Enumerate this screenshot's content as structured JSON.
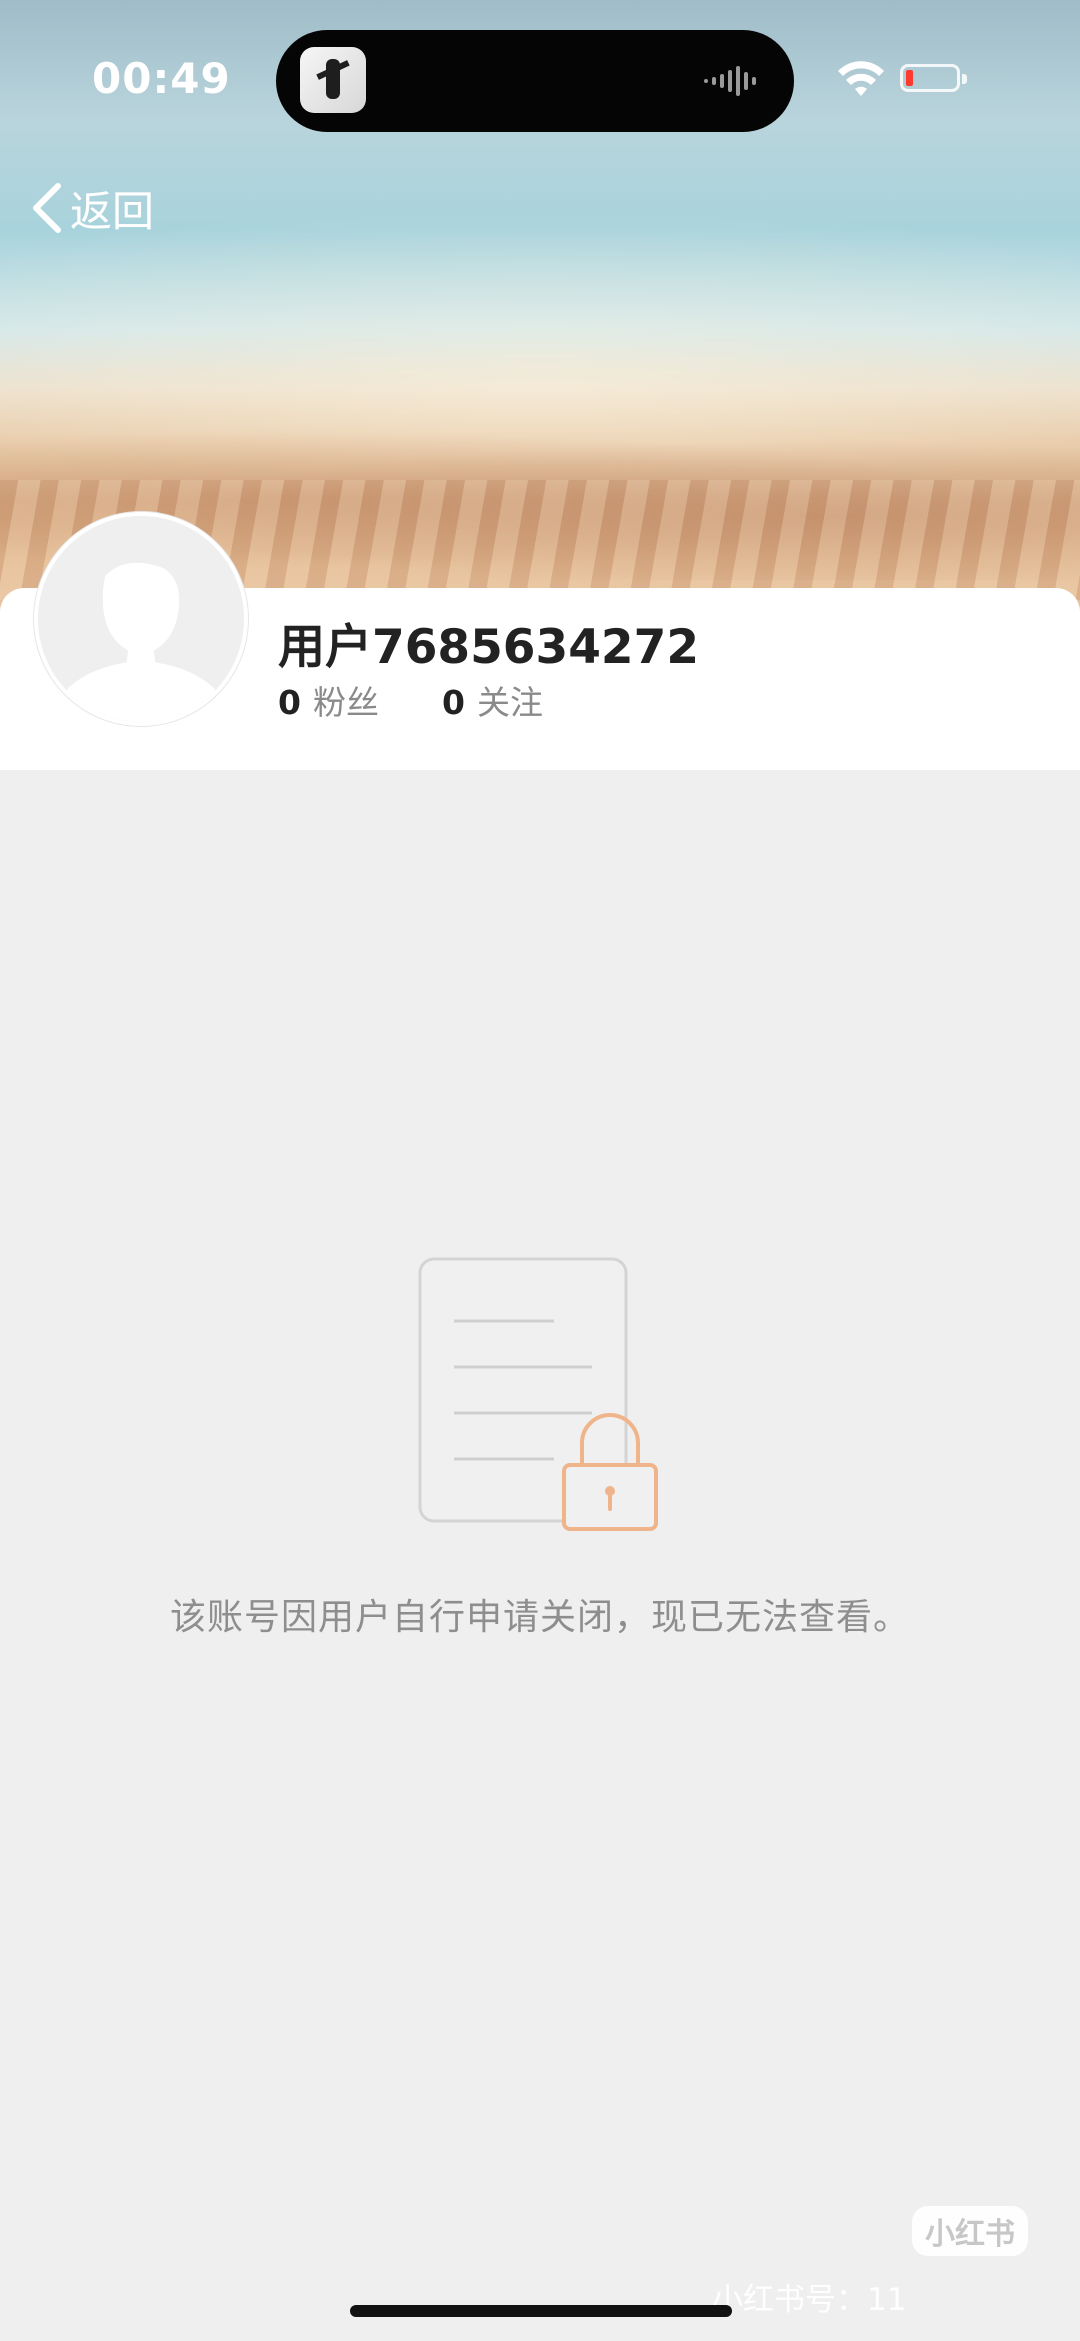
{
  "status_bar": {
    "time": "00:49"
  },
  "nav": {
    "back_label": "返回"
  },
  "profile": {
    "username": "用户7685634272",
    "followers_count": "0",
    "followers_label": "粉丝",
    "following_count": "0",
    "following_label": "关注"
  },
  "empty_state": {
    "message": "该账号因用户自行申请关闭，现已无法查看。"
  },
  "watermark": {
    "logo_text": "小红书",
    "id_text": "小红书号：11"
  },
  "colors": {
    "lock_accent": "#f0b48a",
    "background": "#efefef"
  }
}
